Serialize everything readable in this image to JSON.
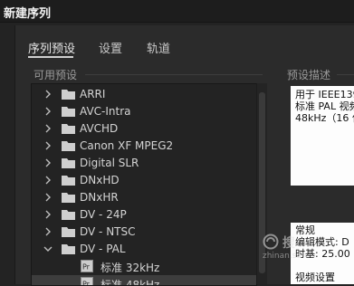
{
  "window": {
    "title": "新建序列"
  },
  "tabs": [
    {
      "label": "序列预设"
    },
    {
      "label": "设置"
    },
    {
      "label": "轨道"
    }
  ],
  "presets": {
    "header": "可用预设",
    "items": [
      {
        "label": "ARRI",
        "kind": "folder",
        "expanded": false
      },
      {
        "label": "AVC-Intra",
        "kind": "folder",
        "expanded": false
      },
      {
        "label": "AVCHD",
        "kind": "folder",
        "expanded": false
      },
      {
        "label": "Canon XF MPEG2",
        "kind": "folder",
        "expanded": false
      },
      {
        "label": "Digital SLR",
        "kind": "folder",
        "expanded": false
      },
      {
        "label": "DNxHD",
        "kind": "folder",
        "expanded": false
      },
      {
        "label": "DNxHR",
        "kind": "folder",
        "expanded": false
      },
      {
        "label": "DV - 24P",
        "kind": "folder",
        "expanded": false
      },
      {
        "label": "DV - NTSC",
        "kind": "folder",
        "expanded": false
      },
      {
        "label": "DV - PAL",
        "kind": "folder",
        "expanded": true
      },
      {
        "label": "标准 32kHz",
        "kind": "file"
      },
      {
        "label": "标准 48kHz",
        "kind": "file",
        "selected": true
      }
    ]
  },
  "description": {
    "header": "预设描述",
    "box1_lines": [
      "用于 IEEE139",
      "标准 PAL 视频",
      "48kHz（16 位"
    ],
    "box2_lines": [
      "常规",
      "编辑模式: D",
      "时基: 25.00",
      "",
      "视频设置"
    ]
  },
  "watermark": {
    "text": "搜",
    "sub": "zhinan.so"
  }
}
